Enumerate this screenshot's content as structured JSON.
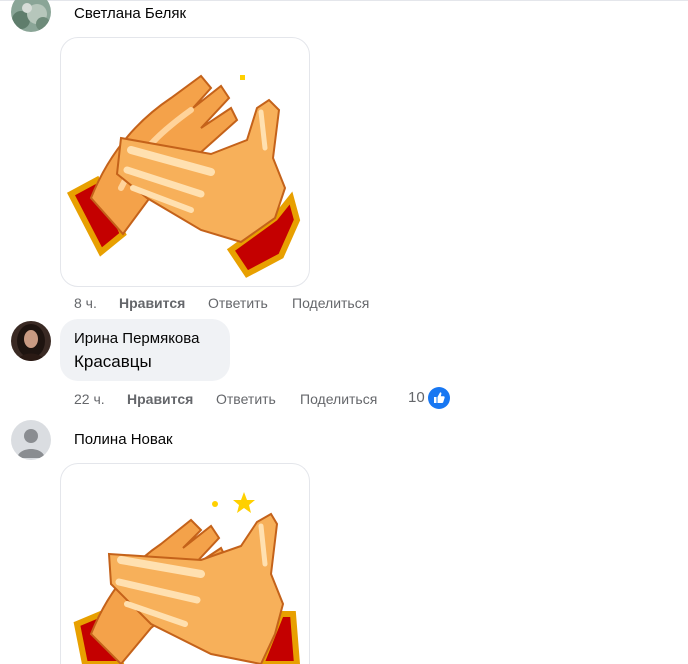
{
  "colors": {
    "bubble_bg": "#f0f2f5",
    "meta_text": "#65676b",
    "like_blue": "#1877f2"
  },
  "comments": [
    {
      "author": "Светлана Беляк",
      "type": "sticker",
      "sticker": "clapping-hands-sticker",
      "time": "8 ч.",
      "like_label": "Нравится",
      "reply_label": "Ответить",
      "share_label": "Поделиться"
    },
    {
      "author": "Ирина Пермякова",
      "type": "text",
      "text": "Красавцы",
      "time": "22 ч.",
      "like_label": "Нравится",
      "reply_label": "Ответить",
      "share_label": "Поделиться",
      "reaction_count": "10",
      "reaction_icon": "thumbs-up-icon"
    },
    {
      "author": "Полина Новак",
      "type": "sticker",
      "sticker": "clapping-hands-sticker"
    }
  ]
}
